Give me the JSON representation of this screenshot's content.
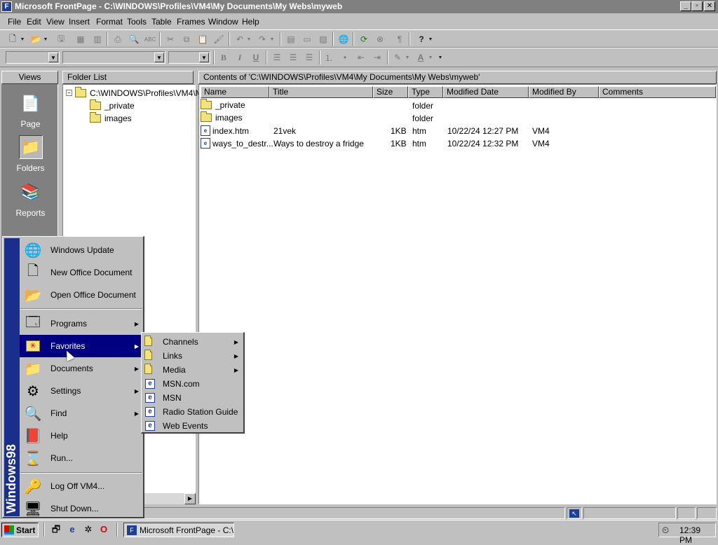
{
  "window": {
    "title": "Microsoft FrontPage - C:\\WINDOWS\\Profiles\\VM4\\My Documents\\My Webs\\myweb"
  },
  "menubar": [
    {
      "label": "File"
    },
    {
      "label": "Edit"
    },
    {
      "label": "View"
    },
    {
      "label": "Insert"
    },
    {
      "label": "Format"
    },
    {
      "label": "Tools"
    },
    {
      "label": "Table"
    },
    {
      "label": "Frames"
    },
    {
      "label": "Window"
    },
    {
      "label": "Help"
    }
  ],
  "format_toolbar": {
    "bold": "B",
    "italic": "I",
    "underline": "U",
    "font_color": "A"
  },
  "views": {
    "header": "Views",
    "items": [
      {
        "label": "Page",
        "icon": "page-view-icon"
      },
      {
        "label": "Folders",
        "icon": "folders-view-icon"
      },
      {
        "label": "Reports",
        "icon": "reports-view-icon"
      }
    ]
  },
  "folder_list": {
    "header": "Folder List",
    "root": "C:\\WINDOWS\\Profiles\\VM4\\M",
    "children": [
      "_private",
      "images"
    ]
  },
  "contents": {
    "header": "Contents of 'C:\\WINDOWS\\Profiles\\VM4\\My Documents\\My Webs\\myweb'",
    "columns": [
      "Name",
      "Title",
      "Size",
      "Type",
      "Modified Date",
      "Modified By",
      "Comments"
    ],
    "rows": [
      {
        "name": "_private",
        "title": "",
        "size": "",
        "type": "folder",
        "modified_date": "",
        "modified_by": "",
        "icon": "folder-icon"
      },
      {
        "name": "images",
        "title": "",
        "size": "",
        "type": "folder",
        "modified_date": "",
        "modified_by": "",
        "icon": "folder-icon"
      },
      {
        "name": "index.htm",
        "title": "21vek",
        "size": "1KB",
        "type": "htm",
        "modified_date": "10/22/24 12:27 PM",
        "modified_by": "VM4",
        "icon": "html-file-icon"
      },
      {
        "name": "ways_to_destr...",
        "title": "Ways to destroy a fridge",
        "size": "1KB",
        "type": "htm",
        "modified_date": "10/22/24 12:32 PM",
        "modified_by": "VM4",
        "icon": "html-file-icon"
      }
    ]
  },
  "start_menu": {
    "banner": "Windows98",
    "items": [
      {
        "label": "Windows Update",
        "icon": "globe-icon"
      },
      {
        "label": "New Office Document",
        "icon": "new-document-icon"
      },
      {
        "label": "Open Office Document",
        "icon": "open-document-icon"
      },
      {
        "label": "Programs",
        "icon": "programs-icon",
        "submenu": true
      },
      {
        "label": "Favorites",
        "icon": "favorites-icon",
        "submenu": true,
        "highlighted": true
      },
      {
        "label": "Documents",
        "icon": "documents-icon",
        "submenu": true
      },
      {
        "label": "Settings",
        "icon": "settings-icon",
        "submenu": true
      },
      {
        "label": "Find",
        "icon": "find-icon",
        "submenu": true
      },
      {
        "label": "Help",
        "icon": "help-book-icon"
      },
      {
        "label": "Run...",
        "icon": "run-icon"
      },
      {
        "label": "Log Off VM4...",
        "icon": "keys-icon"
      },
      {
        "label": "Shut Down...",
        "icon": "shutdown-icon"
      }
    ]
  },
  "favorites_menu": {
    "items": [
      {
        "label": "Channels",
        "icon": "folder-icon",
        "submenu": true
      },
      {
        "label": "Links",
        "icon": "folder-icon",
        "submenu": true
      },
      {
        "label": "Media",
        "icon": "folder-icon",
        "submenu": true
      },
      {
        "label": "MSN.com",
        "icon": "ie-link-icon"
      },
      {
        "label": "MSN",
        "icon": "ie-link-icon"
      },
      {
        "label": "Radio Station Guide",
        "icon": "ie-link-icon"
      },
      {
        "label": "Web Events",
        "icon": "ie-link-icon"
      }
    ]
  },
  "taskbar": {
    "start_label": "Start",
    "task_label": "Microsoft FrontPage - C:\\...",
    "clock": "12:39 PM"
  },
  "colors": {
    "highlight": "#000080",
    "banner": "#1a2e8c",
    "desktop_gray": "#c0c0c0",
    "views_panel": "#808080"
  }
}
